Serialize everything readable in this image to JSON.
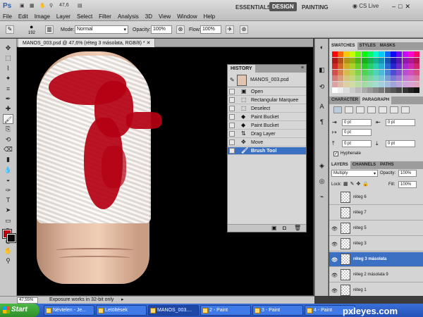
{
  "app": {
    "logo": "Ps",
    "zoom_pct": "47,6"
  },
  "menu": [
    "File",
    "Edit",
    "Image",
    "Layer",
    "Select",
    "Filter",
    "Analysis",
    "3D",
    "View",
    "Window",
    "Help"
  ],
  "workspaces": {
    "essentials": "ESSENTIALS",
    "design": "DESIGN",
    "painting": "PAINTING",
    "cslive": "CS Live"
  },
  "options": {
    "brush_size": "192",
    "mode_label": "Mode:",
    "mode_value": "Normal",
    "opacity_label": "Opacity:",
    "opacity_value": "100%",
    "flow_label": "Flow:",
    "flow_value": "100%"
  },
  "document": {
    "tab_title": "MANOS_003.psd @ 47,6% (réteg 3 másolata, RGB/8) *"
  },
  "history": {
    "tab": "HISTORY",
    "snapshot": "MANOS_003.psd",
    "items": [
      "Open",
      "Rectangular Marquee",
      "Deselect",
      "Paint Bucket",
      "Paint Bucket",
      "Drag Layer",
      "Move",
      "Brush Tool"
    ],
    "active_index": 7
  },
  "panels": {
    "swatches_tabs": [
      "SWATCHES",
      "STYLES",
      "MASKS"
    ],
    "char_tabs": [
      "CHARACTER",
      "PARAGRAPH"
    ],
    "para_fields": [
      "0 pt",
      "0 pt",
      "0 pt",
      "0 pt",
      "0 pt"
    ],
    "hyphenate": "Hyphenate",
    "layers_tabs": [
      "LAYERS",
      "CHANNELS",
      "PATHS"
    ],
    "blend_mode": "Multiply",
    "opacity_label": "Opacity:",
    "opacity_value": "100%",
    "lock_label": "Lock:",
    "fill_label": "Fill:",
    "fill_value": "100%"
  },
  "layers": [
    {
      "name": "réteg 6",
      "visible": false
    },
    {
      "name": "réteg 7",
      "visible": false
    },
    {
      "name": "réteg 5",
      "visible": true
    },
    {
      "name": "réteg 3",
      "visible": true
    },
    {
      "name": "réteg 3 másolata",
      "visible": true,
      "active": true
    },
    {
      "name": "réteg 2 másolata 9",
      "visible": true
    },
    {
      "name": "réteg 1",
      "visible": true
    }
  ],
  "status": {
    "zoom": "47,55%",
    "message": "Exposure works in 32-bit only"
  },
  "taskbar": {
    "start": "Start",
    "tasks": [
      "Névtelen - Je...",
      "Letöltések",
      "MANOS_003....",
      "2 - Paint",
      "3 - Paint",
      "4 - Paint"
    ]
  },
  "watermark": "pxleyes.com",
  "colors": {
    "foreground": "#c0000a",
    "background": "#000000",
    "accent": "#3c70c2"
  },
  "icons": {
    "tools": [
      "move-icon",
      "marquee-icon",
      "lasso-icon",
      "quick-select-icon",
      "crop-icon",
      "eyedropper-icon",
      "healing-icon",
      "brush-icon",
      "stamp-icon",
      "history-brush-icon",
      "eraser-icon",
      "gradient-icon",
      "blur-icon",
      "dodge-icon",
      "pen-icon",
      "type-icon",
      "path-select-icon",
      "shape-icon",
      "3d-rotate-icon",
      "3d-orbit-icon",
      "hand-icon",
      "zoom-icon"
    ]
  }
}
